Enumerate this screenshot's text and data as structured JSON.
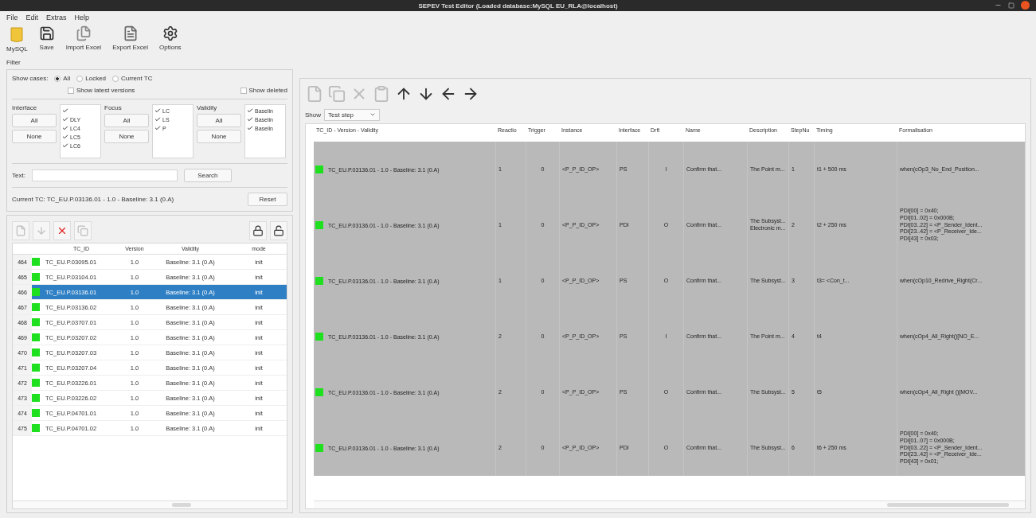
{
  "window": {
    "title": "SEPEV Test Editor (Loaded database:MySQL EU_RLA@localhost)"
  },
  "menu": [
    "File",
    "Edit",
    "Extras",
    "Help"
  ],
  "toolbar": [
    {
      "kind": "database",
      "label": "MySQL"
    },
    {
      "kind": "save",
      "label": "Save"
    },
    {
      "kind": "import",
      "label": "Import Excel"
    },
    {
      "kind": "export",
      "label": "Export Excel"
    },
    {
      "kind": "options",
      "label": "Options"
    }
  ],
  "filter": {
    "title": "Filter",
    "show_cases_label": "Show cases:",
    "show_cases": [
      {
        "label": "All",
        "selected": true
      },
      {
        "label": "Locked",
        "selected": false
      },
      {
        "label": "Current TC",
        "selected": false
      }
    ],
    "options": [
      {
        "label": "Show latest versions",
        "checked": false
      },
      {
        "label": "Show deleted",
        "checked": false
      }
    ],
    "groups": [
      {
        "label": "Interface",
        "all": "All",
        "none": "None",
        "items": [
          {
            "checked": true
          },
          {
            "label": "DLY",
            "checked": true
          },
          {
            "label": "LC4",
            "checked": true
          },
          {
            "label": "LC5",
            "checked": true
          },
          {
            "label": "LC6",
            "checked": true
          }
        ]
      },
      {
        "label": "Focus",
        "all": "All",
        "none": "None",
        "items": [
          {
            "label": "LC",
            "checked": true
          },
          {
            "label": "LS",
            "checked": true
          },
          {
            "label": "P",
            "checked": true
          }
        ]
      },
      {
        "label": "Validity",
        "all": "All",
        "none": "None",
        "items": [
          {
            "label": "Baselin",
            "checked": true
          },
          {
            "label": "Baselin",
            "checked": true
          },
          {
            "label": "Baselin",
            "checked": true
          }
        ]
      }
    ],
    "text_label": "Text:",
    "search_button": "Search",
    "current_tc": "Current TC: TC_EU.P.03136.01 - 1.0 - Baseline: 3.1 (0.A)",
    "reset_button": "Reset"
  },
  "case_toolbar": [
    {
      "kind": "new",
      "disabled": true
    },
    {
      "kind": "down",
      "disabled": true
    },
    {
      "kind": "delete",
      "disabled": false
    },
    {
      "kind": "copy",
      "disabled": true
    },
    {
      "kind": "lock",
      "disabled": false
    },
    {
      "kind": "unlock",
      "disabled": false
    }
  ],
  "cases": {
    "columns": [
      "TC_ID",
      "Version",
      "Validity",
      "mode"
    ],
    "rows": [
      {
        "num": "464",
        "color": "#1ee01e",
        "id": "TC_EU.P.03095.01",
        "version": "1.0",
        "validity": "Baseline: 3.1 (0.A)",
        "mode": "init",
        "selected": false
      },
      {
        "num": "465",
        "color": "#1ee01e",
        "id": "TC_EU.P.03104.01",
        "version": "1.0",
        "validity": "Baseline: 3.1 (0.A)",
        "mode": "init",
        "selected": false
      },
      {
        "num": "466",
        "color": "#1ee01e",
        "id": "TC_EU.P.03136.01",
        "version": "1.0",
        "validity": "Baseline: 3.1 (0.A)",
        "mode": "init",
        "selected": true
      },
      {
        "num": "467",
        "color": "#1ee01e",
        "id": "TC_EU.P.03136.02",
        "version": "1.0",
        "validity": "Baseline: 3.1 (0.A)",
        "mode": "init",
        "selected": false
      },
      {
        "num": "468",
        "color": "#1ee01e",
        "id": "TC_EU.P.03707.01",
        "version": "1.0",
        "validity": "Baseline: 3.1 (0.A)",
        "mode": "init",
        "selected": false
      },
      {
        "num": "469",
        "color": "#1ee01e",
        "id": "TC_EU.P.03207.02",
        "version": "1.0",
        "validity": "Baseline: 3.1 (0.A)",
        "mode": "init",
        "selected": false
      },
      {
        "num": "470",
        "color": "#1ee01e",
        "id": "TC_EU.P.03207.03",
        "version": "1.0",
        "validity": "Baseline: 3.1 (0.A)",
        "mode": "init",
        "selected": false
      },
      {
        "num": "471",
        "color": "#1ee01e",
        "id": "TC_EU.P.03207.04",
        "version": "1.0",
        "validity": "Baseline: 3.1 (0.A)",
        "mode": "init",
        "selected": false
      },
      {
        "num": "472",
        "color": "#1ee01e",
        "id": "TC_EU.P.03226.01",
        "version": "1.0",
        "validity": "Baseline: 3.1 (0.A)",
        "mode": "init",
        "selected": false
      },
      {
        "num": "473",
        "color": "#1ee01e",
        "id": "TC_EU.P.03226.02",
        "version": "1.0",
        "validity": "Baseline: 3.1 (0.A)",
        "mode": "init",
        "selected": false
      },
      {
        "num": "474",
        "color": "#1ee01e",
        "id": "TC_EU.P.04701.01",
        "version": "1.0",
        "validity": "Baseline: 3.1 (0.A)",
        "mode": "init",
        "selected": false
      },
      {
        "num": "475",
        "color": "#1ee01e",
        "id": "TC_EU.P.04701.02",
        "version": "1.0",
        "validity": "Baseline: 3.1 (0.A)",
        "mode": "init",
        "selected": false
      }
    ]
  },
  "step_toolbar": [
    {
      "kind": "new",
      "disabled": true
    },
    {
      "kind": "copy",
      "disabled": true
    },
    {
      "kind": "delete",
      "disabled": true
    },
    {
      "kind": "paste",
      "disabled": true
    },
    {
      "kind": "up",
      "disabled": false
    },
    {
      "kind": "down",
      "disabled": false
    },
    {
      "kind": "left",
      "disabled": false
    },
    {
      "kind": "right",
      "disabled": false
    }
  ],
  "show": {
    "label": "Show",
    "value": "Test step"
  },
  "steps": {
    "columns": [
      "TC_ID - Version - Validity",
      "Reactio",
      "Trigger",
      "Instance",
      "Interface",
      "Drft",
      "Name",
      "Description",
      "StepNu",
      "Timing",
      "Formalisation"
    ],
    "rows": [
      {
        "color": "#1ee01e",
        "tc": "TC_EU.P.03136.01 - 1.0 - Baseline: 3.1 (0.A)",
        "reaction": "1",
        "trigger": "0",
        "instance": "<P_P_ID_OP>",
        "interface": "PS",
        "dir": "I",
        "name": "Confirm that...",
        "description": [
          "The Point m..."
        ],
        "step": "1",
        "timing": "t1 + 500 ms",
        "formalisation": [
          "when(cOp3_No_End_Position..."
        ]
      },
      {
        "color": "#1ee01e",
        "tc": "TC_EU.P.03136.01 - 1.0 - Baseline: 3.1 (0.A)",
        "reaction": "1",
        "trigger": "0",
        "instance": "<P_P_ID_OP>",
        "interface": "PDI",
        "dir": "O",
        "name": "Confirm that...",
        "description": [
          "The Subsyst...",
          "Electronic m..."
        ],
        "step": "2",
        "timing": "t2 + 250 ms",
        "formalisation": [
          "PDI[00] = 0x40;",
          "PDI[01..02] = 0x000B;",
          "PDI[03..22] = <P_Sender_Ident...",
          "PDI[23..42] = <P_Receiver_Ide...",
          "PDI[43] = 0x03;"
        ]
      },
      {
        "color": "#1ee01e",
        "tc": "TC_EU.P.03136.01 - 1.0 - Baseline: 3.1 (0.A)",
        "reaction": "1",
        "trigger": "0",
        "instance": "<P_P_ID_OP>",
        "interface": "PS",
        "dir": "O",
        "name": "Confirm that...",
        "description": [
          "The Subsyst..."
        ],
        "step": "3",
        "timing": "t3= <Con_t...",
        "formalisation": [
          "when(cOp10_Redrive_Right(Cr..."
        ]
      },
      {
        "color": "#1ee01e",
        "tc": "TC_EU.P.03136.01 - 1.0 - Baseline: 3.1 (0.A)",
        "reaction": "2",
        "trigger": "0",
        "instance": "<P_P_ID_OP>",
        "interface": "PS",
        "dir": "I",
        "name": "Confirm that...",
        "description": [
          "The Point m..."
        ],
        "step": "4",
        "timing": "t4",
        "formalisation": [
          "when(cOp4_All_Right()[NO_E..."
        ]
      },
      {
        "color": "#1ee01e",
        "tc": "TC_EU.P.03136.01 - 1.0 - Baseline: 3.1 (0.A)",
        "reaction": "2",
        "trigger": "0",
        "instance": "<P_P_ID_OP>",
        "interface": "PS",
        "dir": "O",
        "name": "Confirm that...",
        "description": [
          "The Subsyst..."
        ],
        "step": "5",
        "timing": "t5",
        "formalisation": [
          "when(cOp4_All_Right ()[MOV..."
        ]
      },
      {
        "color": "#1ee01e",
        "tc": "TC_EU.P.03136.01 - 1.0 - Baseline: 3.1 (0.A)",
        "reaction": "2",
        "trigger": "0",
        "instance": "<P_P_ID_OP>",
        "interface": "PDI",
        "dir": "O",
        "name": "Confirm that...",
        "description": [
          "The Subsyst..."
        ],
        "step": "6",
        "timing": "t6 + 250 ms",
        "formalisation": [
          "PDI[00] = 0x40;",
          "PDI[01..07] = 0x000B;",
          "PDI[03..22] = <P_Sender_Ident...",
          "PDI[23..42] = <P_Receiver_Ide...",
          "PDI[43] = 0x01;"
        ]
      }
    ]
  }
}
